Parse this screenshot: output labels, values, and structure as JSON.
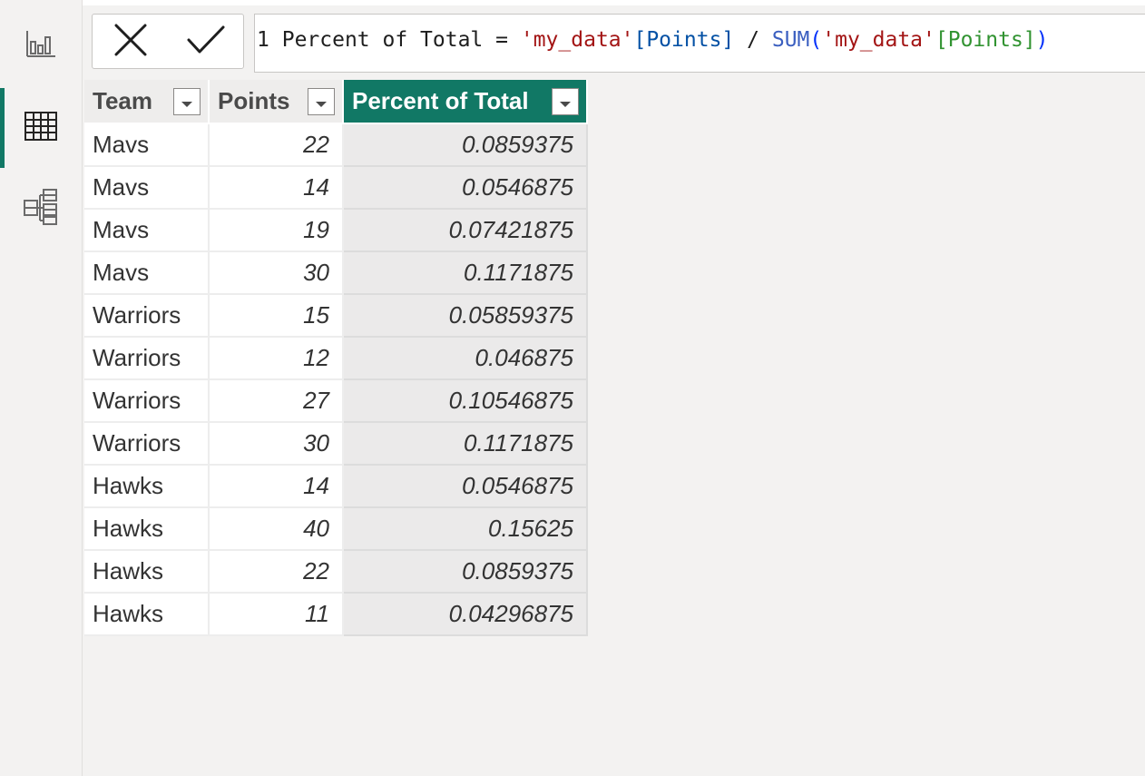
{
  "rail": {
    "items": [
      {
        "name": "report-view",
        "icon": "bar-chart-icon",
        "active": false
      },
      {
        "name": "data-view",
        "icon": "table-grid-icon",
        "active": true
      },
      {
        "name": "model-view",
        "icon": "model-diagram-icon",
        "active": false
      }
    ]
  },
  "formula_bar": {
    "cancel_icon": "close-icon",
    "commit_icon": "checkmark-icon",
    "line_number": "1",
    "measure_name": "Percent of Total",
    "equals": "=",
    "table_ref_1": "'my_data'",
    "column_ref_1": "[Points]",
    "operator": "/",
    "function": "SUM",
    "open_paren": "(",
    "table_ref_2": "'my_data'",
    "column_ref_2": "[Points]",
    "close_paren": ")"
  },
  "table": {
    "columns": [
      "Team",
      "Points",
      "Percent of Total"
    ],
    "selected_column": "Percent of Total",
    "accent_color": "#117865",
    "rows": [
      {
        "team": "Mavs",
        "points": "22",
        "pct": "0.0859375"
      },
      {
        "team": "Mavs",
        "points": "14",
        "pct": "0.0546875"
      },
      {
        "team": "Mavs",
        "points": "19",
        "pct": "0.07421875"
      },
      {
        "team": "Mavs",
        "points": "30",
        "pct": "0.1171875"
      },
      {
        "team": "Warriors",
        "points": "15",
        "pct": "0.05859375"
      },
      {
        "team": "Warriors",
        "points": "12",
        "pct": "0.046875"
      },
      {
        "team": "Warriors",
        "points": "27",
        "pct": "0.10546875"
      },
      {
        "team": "Warriors",
        "points": "30",
        "pct": "0.1171875"
      },
      {
        "team": "Hawks",
        "points": "14",
        "pct": "0.0546875"
      },
      {
        "team": "Hawks",
        "points": "40",
        "pct": "0.15625"
      },
      {
        "team": "Hawks",
        "points": "22",
        "pct": "0.0859375"
      },
      {
        "team": "Hawks",
        "points": "11",
        "pct": "0.04296875"
      }
    ]
  }
}
